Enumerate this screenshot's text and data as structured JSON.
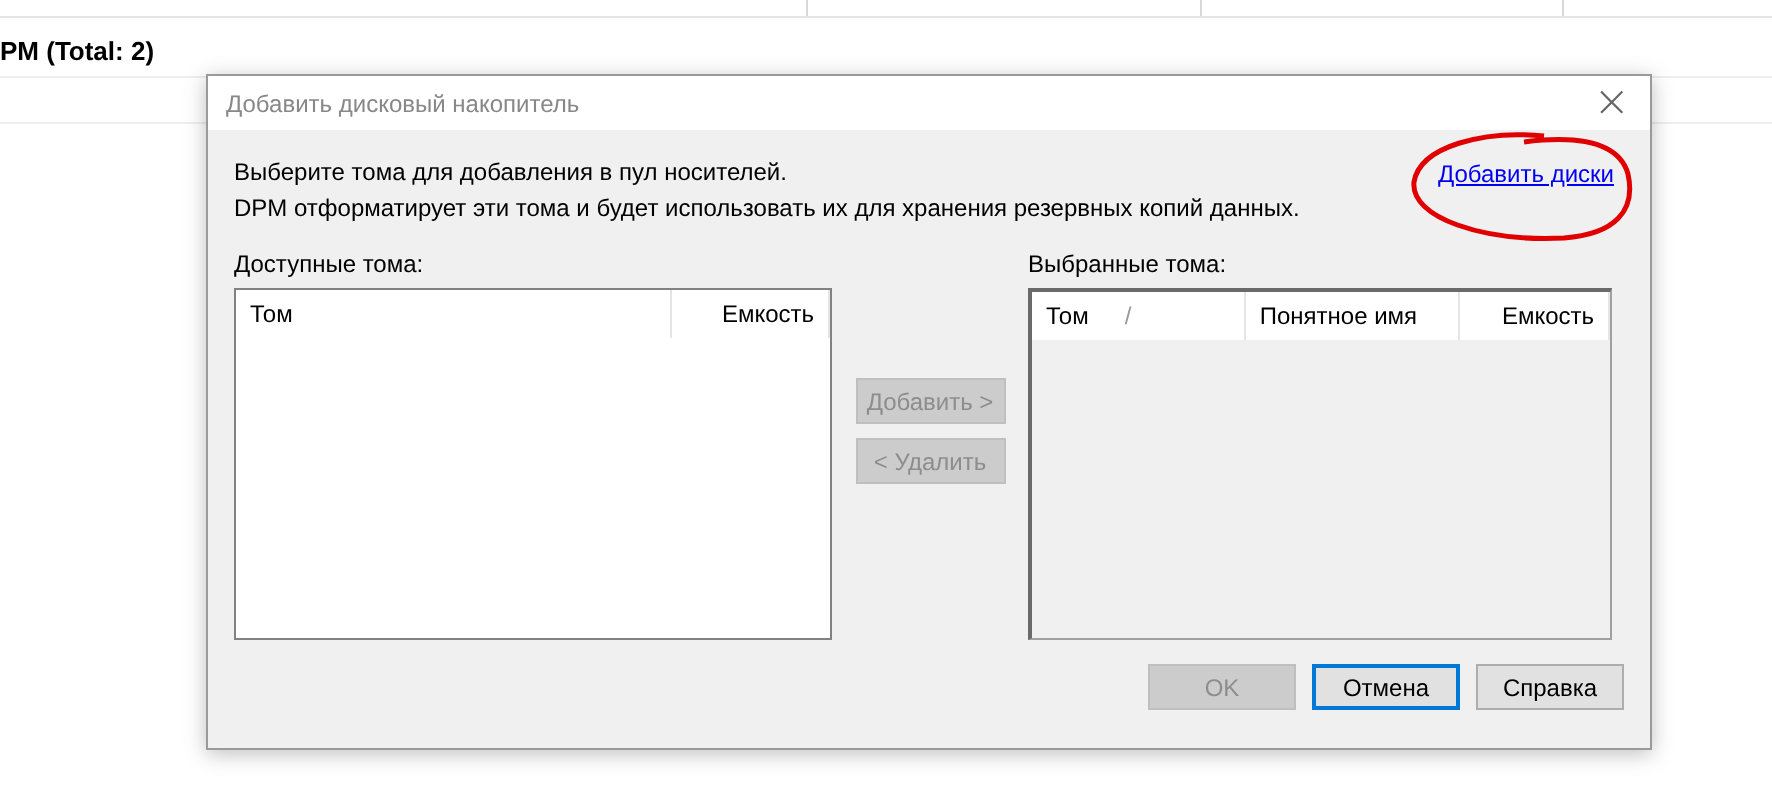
{
  "background": {
    "group_heading": "PM (Total: 2)"
  },
  "dialog": {
    "title": "Добавить дисковый накопитель",
    "close_glyph": "×",
    "instructions": [
      "Выберите тома для добавления в пул носителей.",
      "DPM отформатирует эти тома и будет использовать их для хранения резервных копий данных."
    ],
    "link": "Добавить диски",
    "available": {
      "label": "Доступные тома:",
      "disabled": false,
      "columns": [
        {
          "label": "Том"
        },
        {
          "label": "Емкость"
        }
      ]
    },
    "selected": {
      "label": "Выбранные тома:",
      "disabled": true,
      "columns": [
        {
          "label": "Том",
          "sort_mark": "/"
        },
        {
          "label": "Понятное имя"
        },
        {
          "label": "Емкость"
        }
      ]
    },
    "move_buttons": [
      {
        "label": "Добавить >",
        "disabled": true
      },
      {
        "label": "< Удалить",
        "disabled": true
      }
    ],
    "buttons": [
      {
        "label": "OK",
        "disabled": true,
        "default": false
      },
      {
        "label": "Отмена",
        "disabled": false,
        "default": true
      },
      {
        "label": "Справка",
        "disabled": false,
        "default": false
      }
    ]
  },
  "annotation": {
    "kind": "circle"
  }
}
